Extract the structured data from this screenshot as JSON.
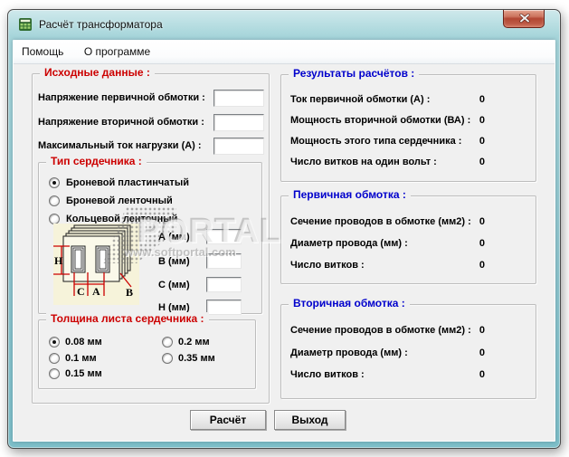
{
  "colors": {
    "group_title_red": "#cc0000",
    "group_title_blue": "#0000cc",
    "titlebar_teal": "#8fc6ce",
    "close_button_red": "#b24733",
    "client_bg": "#f0f0f0"
  },
  "window": {
    "title": "Расчёт трансформатора"
  },
  "menu": {
    "items": [
      {
        "label": "Помощь"
      },
      {
        "label": "О программе"
      }
    ]
  },
  "watermark": {
    "text": "PORTAL",
    "url": "www.softportal.com"
  },
  "source": {
    "title": "Исходные данные :",
    "fields": [
      {
        "label": "Напряжение первичной обмотки :",
        "value": ""
      },
      {
        "label": "Напряжение вторичной обмотки :",
        "value": ""
      },
      {
        "label": "Максимальный ток нагрузки  (А)  :",
        "value": ""
      }
    ],
    "core": {
      "title": "Тип сердечника :",
      "options": [
        {
          "label": "Броневой пластинчатый",
          "selected": true
        },
        {
          "label": "Броневой ленточный",
          "selected": false
        },
        {
          "label": "Кольцевой ленточный",
          "selected": false
        }
      ],
      "diagram": {
        "h": "H",
        "c": "C",
        "a": "A",
        "b": "B"
      },
      "dims": [
        {
          "label": "А (мм)",
          "value": ""
        },
        {
          "label": "В (мм)",
          "value": ""
        },
        {
          "label": "С (мм)",
          "value": ""
        },
        {
          "label": "Н (мм)",
          "value": ""
        }
      ]
    },
    "thickness": {
      "title": "Толщина листа сердечника :",
      "options": [
        {
          "label": "0.08 мм",
          "selected": true
        },
        {
          "label": "0.1 мм",
          "selected": false
        },
        {
          "label": "0.15 мм",
          "selected": false
        },
        {
          "label": "0.2 мм",
          "selected": false
        },
        {
          "label": "0.35 мм",
          "selected": false
        }
      ]
    }
  },
  "results": {
    "title": "Результаты расчётов :",
    "rows": [
      {
        "label": "Ток первичной обмотки (А) :",
        "value": "0"
      },
      {
        "label": "Мощность вторичной обмотки (ВА) :",
        "value": "0"
      },
      {
        "label": "Мощность  этого типа сердечника :",
        "value": "0"
      },
      {
        "label": "Число витков на один вольт :",
        "value": "0"
      }
    ]
  },
  "primary": {
    "title": "Первичная обмотка :",
    "rows": [
      {
        "label": "Сечение проводов в обмотке (мм2) :",
        "value": "0"
      },
      {
        "label": "Диаметр провода (мм) :",
        "value": "0"
      },
      {
        "label": "Число витков :",
        "value": "0"
      }
    ]
  },
  "secondary": {
    "title": "Вторичная обмотка :",
    "rows": [
      {
        "label": "Сечение проводов в обмотке (мм2) :",
        "value": "0"
      },
      {
        "label": "Диаметр провода (мм) :",
        "value": "0"
      },
      {
        "label": "Число витков :",
        "value": "0"
      }
    ]
  },
  "buttons": {
    "calculate": "Расчёт",
    "exit": "Выход"
  }
}
